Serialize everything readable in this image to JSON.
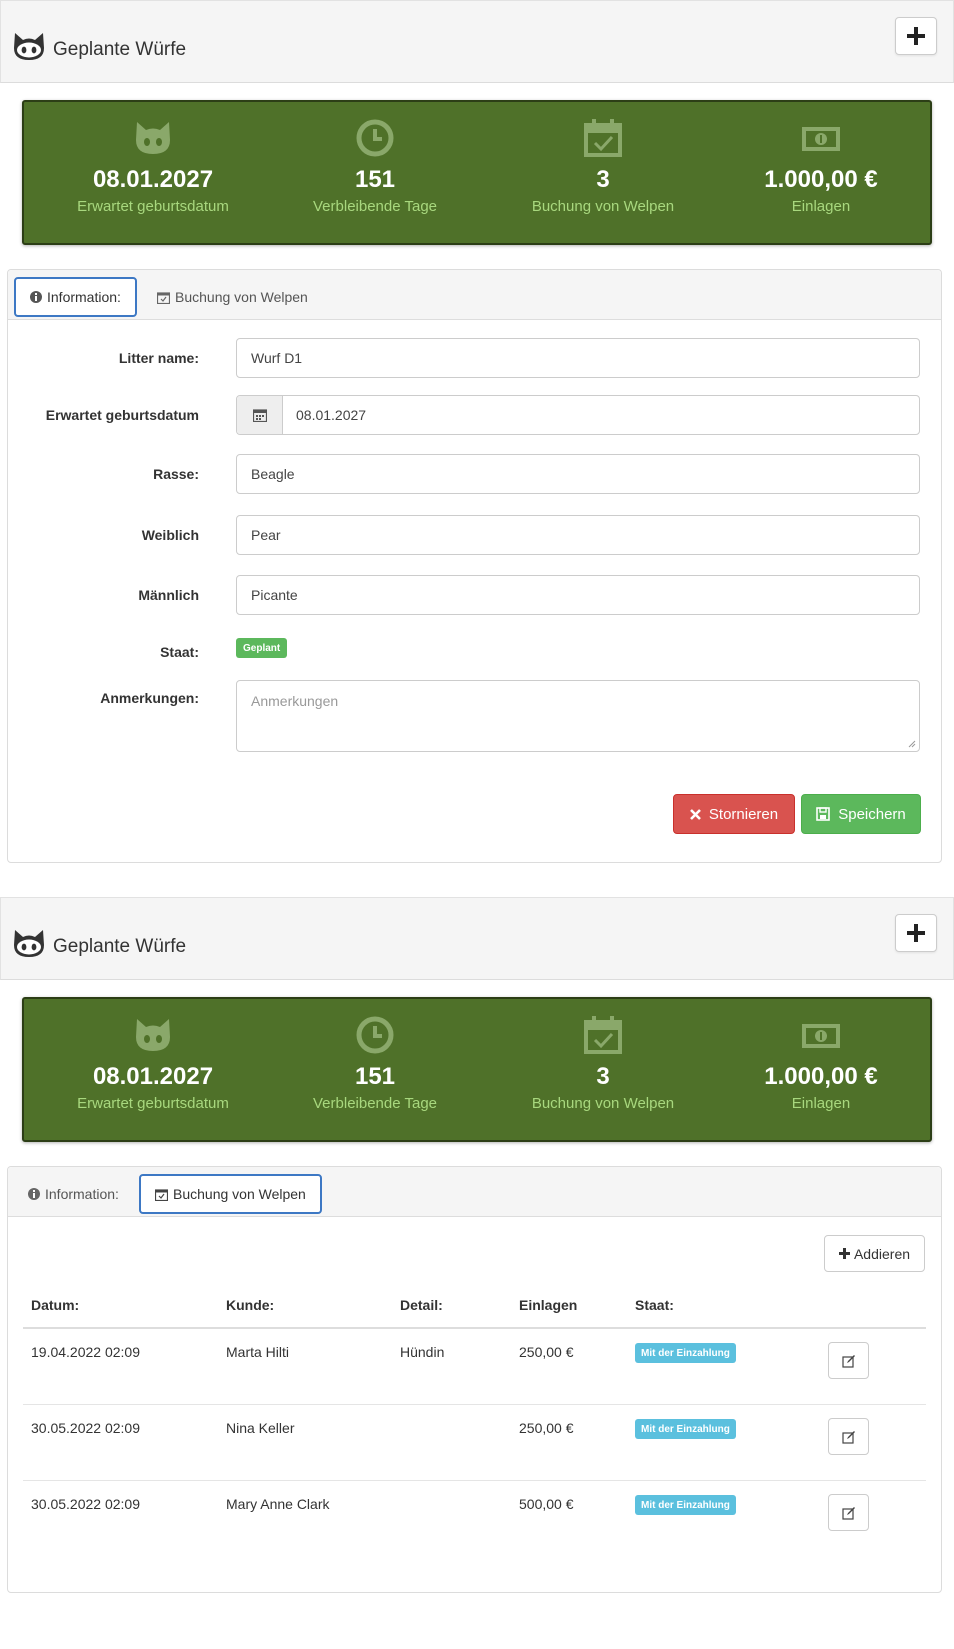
{
  "header": {
    "title": "Geplante Würfe"
  },
  "stats": [
    {
      "icon": "cat-face-icon",
      "value": "08.01.2027",
      "label": "Erwartet geburtsdatum"
    },
    {
      "icon": "clock-icon",
      "value": "151",
      "label": "Verbleibende Tage"
    },
    {
      "icon": "calendar-check-icon",
      "value": "3",
      "label": "Buchung von Welpen"
    },
    {
      "icon": "money-icon",
      "value": "1.000,00 €",
      "label": "Einlagen"
    }
  ],
  "tabs": {
    "information": "Information:",
    "booking": "Buchung von Welpen"
  },
  "form": {
    "litter_name_label": "Litter name:",
    "litter_name_value": "Wurf D1",
    "birthdate_label": "Erwartet geburtsdatum",
    "birthdate_value": "08.01.2027",
    "breed_label": "Rasse:",
    "breed_value": "Beagle",
    "female_label": "Weiblich",
    "female_value": "Pear",
    "male_label": "Männlich",
    "male_value": "Picante",
    "state_label": "Staat:",
    "state_value": "Geplant",
    "notes_label": "Anmerkungen:",
    "notes_placeholder": "Anmerkungen",
    "cancel_label": "Stornieren",
    "save_label": "Speichern"
  },
  "booking": {
    "add_label": "Addieren",
    "columns": [
      "Datum:",
      "Kunde:",
      "Detail:",
      "Einlagen",
      "Staat:"
    ],
    "rows": [
      {
        "date": "19.04.2022 02:09",
        "customer": "Marta Hilti",
        "detail": "Hündin",
        "deposit": "250,00 €",
        "state": "Mit der Einzahlung"
      },
      {
        "date": "30.05.2022 02:09",
        "customer": "Nina Keller",
        "detail": "",
        "deposit": "250,00 €",
        "state": "Mit der Einzahlung"
      },
      {
        "date": "30.05.2022 02:09",
        "customer": "Mary Anne Clark",
        "detail": "",
        "deposit": "500,00 €",
        "state": "Mit der Einzahlung"
      }
    ]
  },
  "colors": {
    "stats_bg": "#4f7129",
    "stats_label": "#a8d87e",
    "danger": "#d9534f",
    "success": "#5cb85c",
    "info": "#5bc0de",
    "tab_active_border": "#3d78c4"
  }
}
